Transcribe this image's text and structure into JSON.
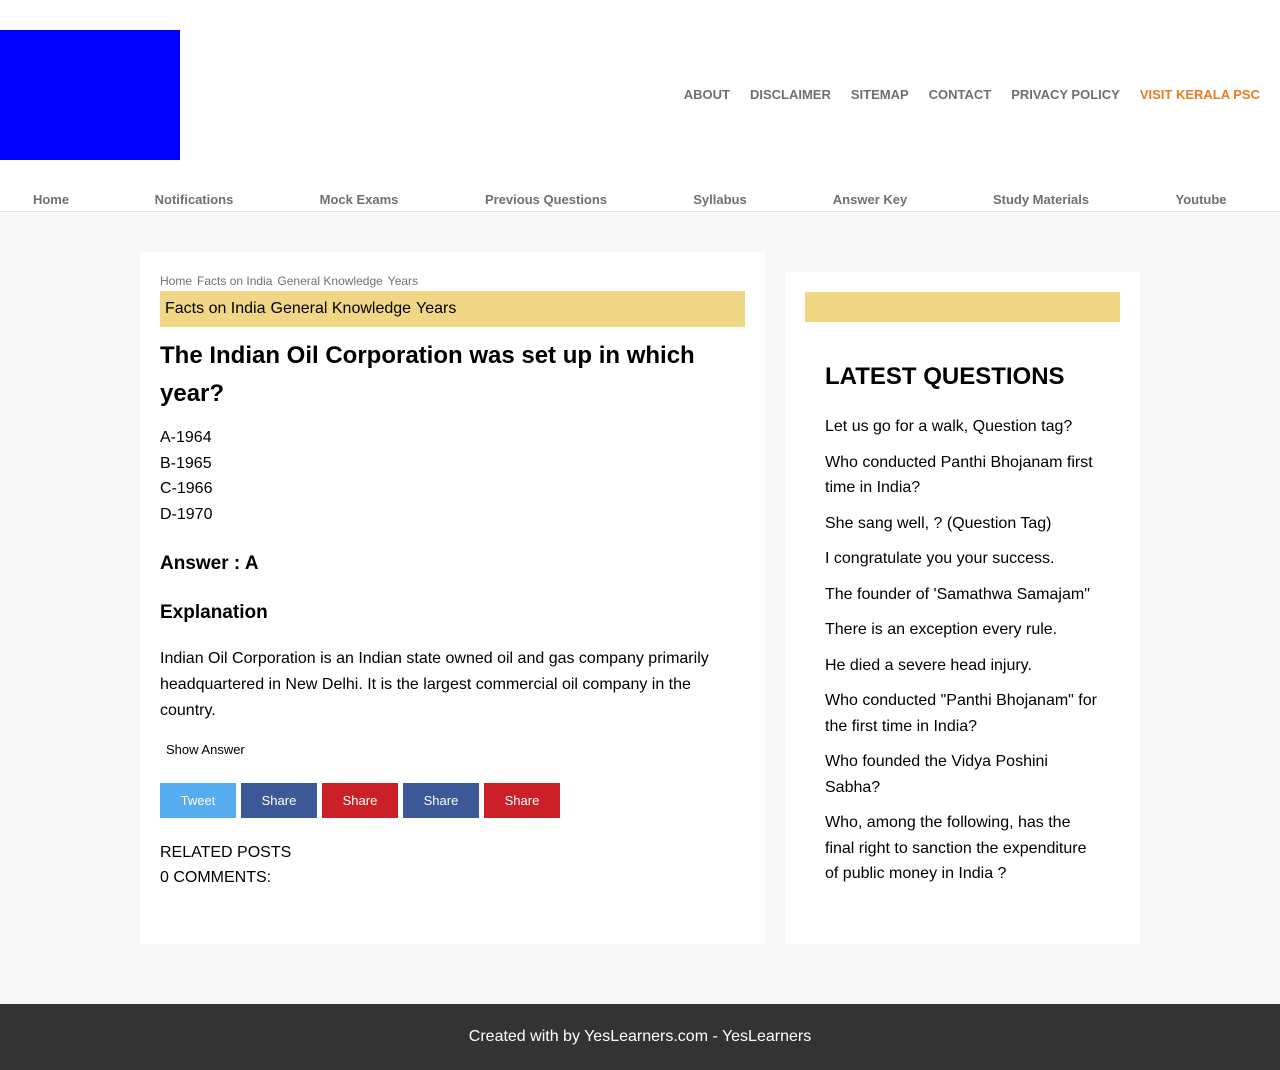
{
  "header": {
    "top_links": [
      {
        "label": "ABOUT"
      },
      {
        "label": "DISCLAIMER"
      },
      {
        "label": "SITEMAP"
      },
      {
        "label": "CONTACT"
      },
      {
        "label": "PRIVACY POLICY"
      },
      {
        "label": "VISIT KERALA PSC"
      }
    ],
    "accent_color": "#e67e22",
    "logo_color": "#0000ff"
  },
  "nav": [
    {
      "label": "Home"
    },
    {
      "label": "Notifications"
    },
    {
      "label": "Mock Exams"
    },
    {
      "label": "Previous Questions"
    },
    {
      "label": "Syllabus"
    },
    {
      "label": "Answer Key"
    },
    {
      "label": "Study Materials"
    },
    {
      "label": "Youtube"
    }
  ],
  "breadcrumb": [
    "Home",
    "Facts on India",
    "General Knowledge",
    "Years"
  ],
  "labels": [
    "Facts on India",
    "General Knowledge",
    "Years"
  ],
  "post": {
    "title": "The Indian Oil Corporation was set up in which year?",
    "options": [
      "A-1964",
      "B-1965",
      "C-1966",
      "D-1970"
    ],
    "answer": "Answer : A",
    "explanation_heading": "Explanation",
    "explanation": "Indian Oil Corporation is an Indian state owned oil and gas company primarily headquartered in New Delhi. It is the largest commercial oil company in the country.",
    "show_answer_label": "Show Answer",
    "share_buttons": [
      {
        "label": "Tweet",
        "color": "#55acee"
      },
      {
        "label": "Share",
        "color": "#3b5998"
      },
      {
        "label": "Share",
        "color": "#cb2027"
      },
      {
        "label": "Share",
        "color": "#3b5998"
      },
      {
        "label": "Share",
        "color": "#cb2027"
      }
    ],
    "related_posts": "RELATED POSTS",
    "comments": "0 COMMENTS:"
  },
  "sidebar": {
    "title": "LATEST QUESTIONS",
    "questions": [
      "Let us go for a walk, Question tag?",
      "Who conducted Panthi Bhojanam first time in India?",
      "She sang well, ? (Question Tag)",
      "I congratulate you your success.",
      "The founder of 'Samathwa Samajam\"",
      "There is an exception every rule.",
      "He died a severe head injury.",
      "Who conducted \"Panthi Bhojanam\" for the first time in India?",
      "Who founded the Vidya Poshini Sabha?",
      "Who, among the following, has the final right to sanction the expenditure of public money in India ?"
    ]
  },
  "footer": {
    "text": "Created with by YesLearners.com - YesLearners"
  }
}
